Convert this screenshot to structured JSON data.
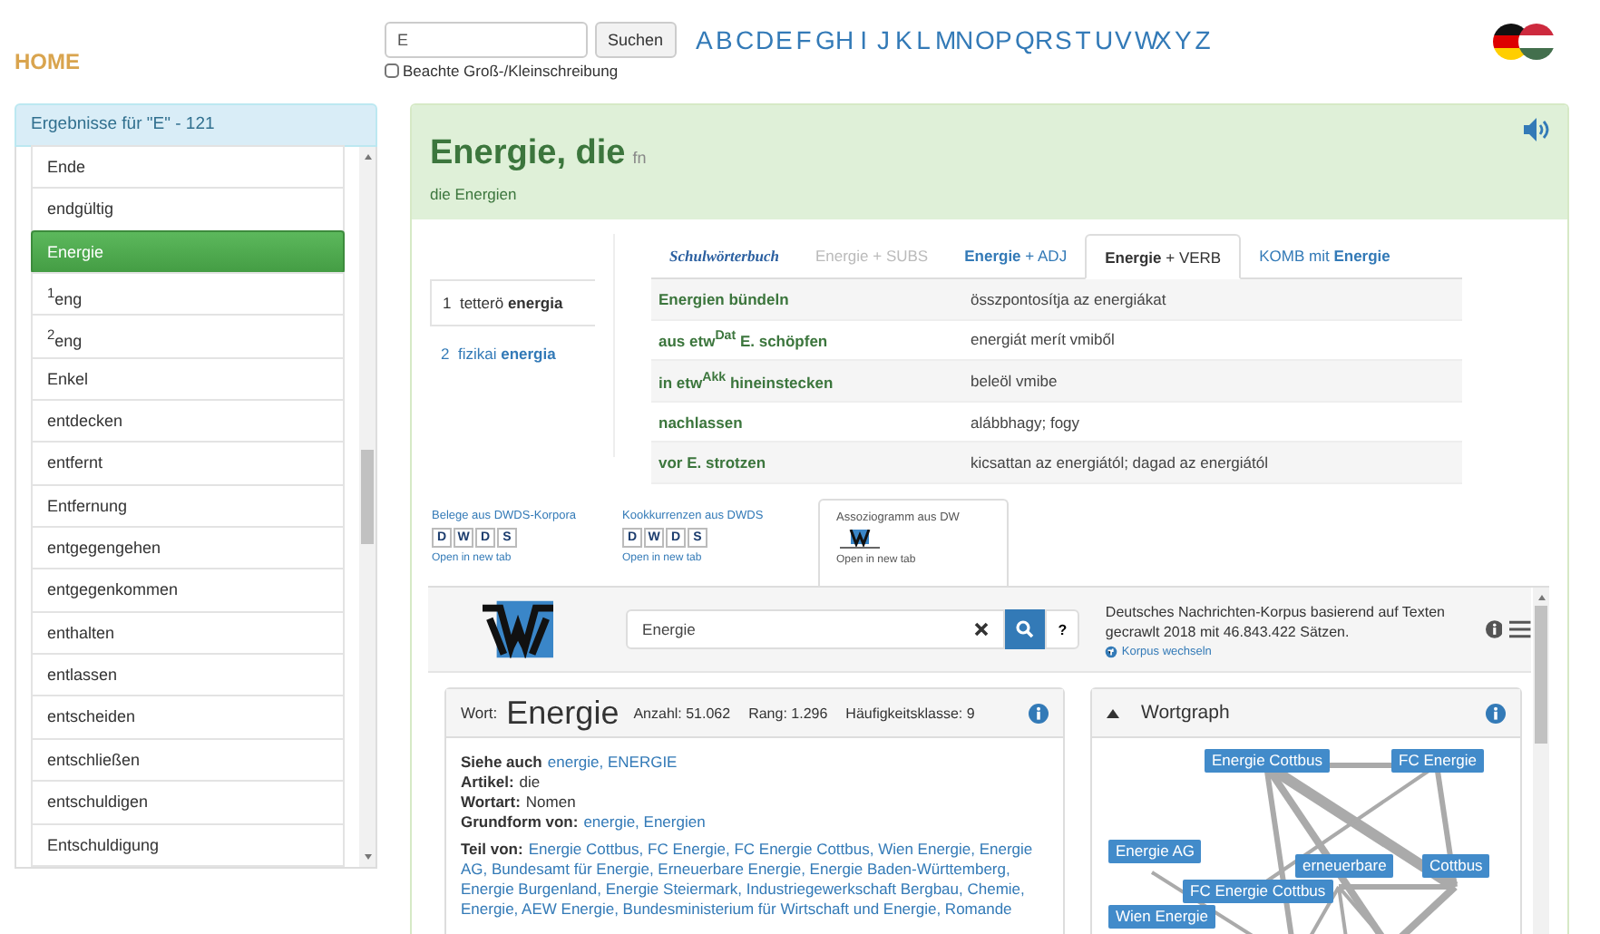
{
  "header": {
    "home": "HOME",
    "search": {
      "value": "E",
      "button": "Suchen"
    },
    "case_option": {
      "label": "Beachte Groß-/Kleinschreibung",
      "checked": false
    },
    "letters": [
      "A",
      "B",
      "C",
      "D",
      "E",
      "F",
      "G",
      "H",
      "I",
      "J",
      "K",
      "L",
      "M",
      "N",
      "O",
      "P",
      "Q",
      "R",
      "S",
      "T",
      "U",
      "V",
      "W",
      "X",
      "Y",
      "Z"
    ]
  },
  "results": {
    "title": "Ergebnisse für \"E\" - 121",
    "items": [
      {
        "label": "Ende",
        "selected": false
      },
      {
        "label": "endgültig",
        "selected": false
      },
      {
        "label": "Energie",
        "selected": true
      },
      {
        "label": "$^{1}$eng",
        "selected": false
      },
      {
        "label": "$^{2}$eng",
        "selected": false
      },
      {
        "label": "Enkel",
        "selected": false
      },
      {
        "label": "entdecken",
        "selected": false
      },
      {
        "label": "entfernt",
        "selected": false
      },
      {
        "label": "Entfernung",
        "selected": false
      },
      {
        "label": "entgegengehen",
        "selected": false
      },
      {
        "label": "entgegenkommen",
        "selected": false
      },
      {
        "label": "enthalten",
        "selected": false
      },
      {
        "label": "entlassen",
        "selected": false
      },
      {
        "label": "entscheiden",
        "selected": false
      },
      {
        "label": "entschließen",
        "selected": false
      },
      {
        "label": "entschuldigen",
        "selected": false
      },
      {
        "label": "Entschuldigung",
        "selected": false
      }
    ]
  },
  "entry": {
    "headword": "Energie, die",
    "pos": "fn",
    "plural": "die Energien",
    "meanings": [
      {
        "number": "1",
        "text": "tetterö **energia**",
        "selected": true
      },
      {
        "number": "2",
        "text": "fizikai **energia**",
        "selected": false
      }
    ],
    "tabs": [
      {
        "label": "Schulwörterbuch",
        "kind": "logo",
        "selected": false,
        "disabled": false
      },
      {
        "label": "Energie + SUBS",
        "kind": "plain",
        "selected": false,
        "disabled": true
      },
      {
        "label": "**Energie** + ADJ",
        "kind": "plain",
        "selected": false,
        "disabled": false
      },
      {
        "label": "**Energie** + VERB",
        "kind": "plain",
        "selected": true,
        "disabled": false
      },
      {
        "label": "KOMB mit **Energie**",
        "kind": "plain",
        "selected": false,
        "disabled": false
      }
    ],
    "rows": [
      {
        "german": "Energien bündeln",
        "hungarian": "összpontosítja az energiákat"
      },
      {
        "german": "aus etw$^{Dat}$ E. schöpfen",
        "hungarian": "energiát merít vmiből"
      },
      {
        "german": "in etw$^{Akk}$ hineinstecken",
        "hungarian": "beleöl vmibe"
      },
      {
        "german": "nachlassen",
        "hungarian": "alábbhagy; fogy"
      },
      {
        "german": "vor E. strotzen",
        "hungarian": "kicsattan az energiától; dagad az energiától"
      }
    ]
  },
  "corpus_tabs": [
    {
      "title": "Belege aus DWDS-Korpora",
      "kind": "dwds",
      "logo_letters": [
        "D",
        "W",
        "D",
        "S"
      ],
      "link": "Open in new tab",
      "selected": false
    },
    {
      "title": "Kookkurrenzen aus DWDS",
      "kind": "dwds",
      "logo_letters": [
        "D",
        "W",
        "D",
        "S"
      ],
      "link": "Open in new tab",
      "selected": false
    },
    {
      "title": "Assoziogramm aus DW",
      "kind": "wortschatz",
      "link": "Open in new tab",
      "selected": true
    }
  ],
  "wortschatz": {
    "search_value": "Energie",
    "help": "?",
    "description": "Deutsches Nachrichten-Korpus basierend auf Texten gecrawlt 2018 mit 46.843.422 Sätzen.",
    "switch_link": "Korpus wechseln",
    "word_card": {
      "label": "Wort:",
      "word": "Energie",
      "stats": [
        "Anzahl: 51.062",
        "Rang: 1.296",
        "Häufigkeitsklasse: 9"
      ],
      "fields": [
        {
          "label": "Siehe auch",
          "value": "energie, ENERGIE",
          "kind": "links"
        },
        {
          "label": "Artikel:",
          "value": "die",
          "kind": "text"
        },
        {
          "label": "Wortart:",
          "value": "Nomen",
          "kind": "text"
        },
        {
          "label": "Grundform von:",
          "value": "energie, Energien",
          "kind": "links"
        }
      ],
      "part_of": {
        "label": "Teil von:",
        "value": "Energie Cottbus, FC Energie, FC Energie Cottbus, Wien Energie, Energie AG, Bundesamt für Energie, Erneuerbare Energie, Energie Baden-Württemberg, Energie Burgenland, Energie Steiermark, Industriegewerkschaft Bergbau, Chemie, Energie, AEW Energie, Bundesministerium für Wirtschaft und Energie, Romande"
      }
    },
    "graph": {
      "title": "Wortgraph",
      "expanded": true,
      "nodes": [
        "Energie Cottbus",
        "FC Energie",
        "Energie AG",
        "erneuerbare",
        "Cottbus",
        "FC Energie Cottbus",
        "Wien Energie"
      ]
    }
  }
}
